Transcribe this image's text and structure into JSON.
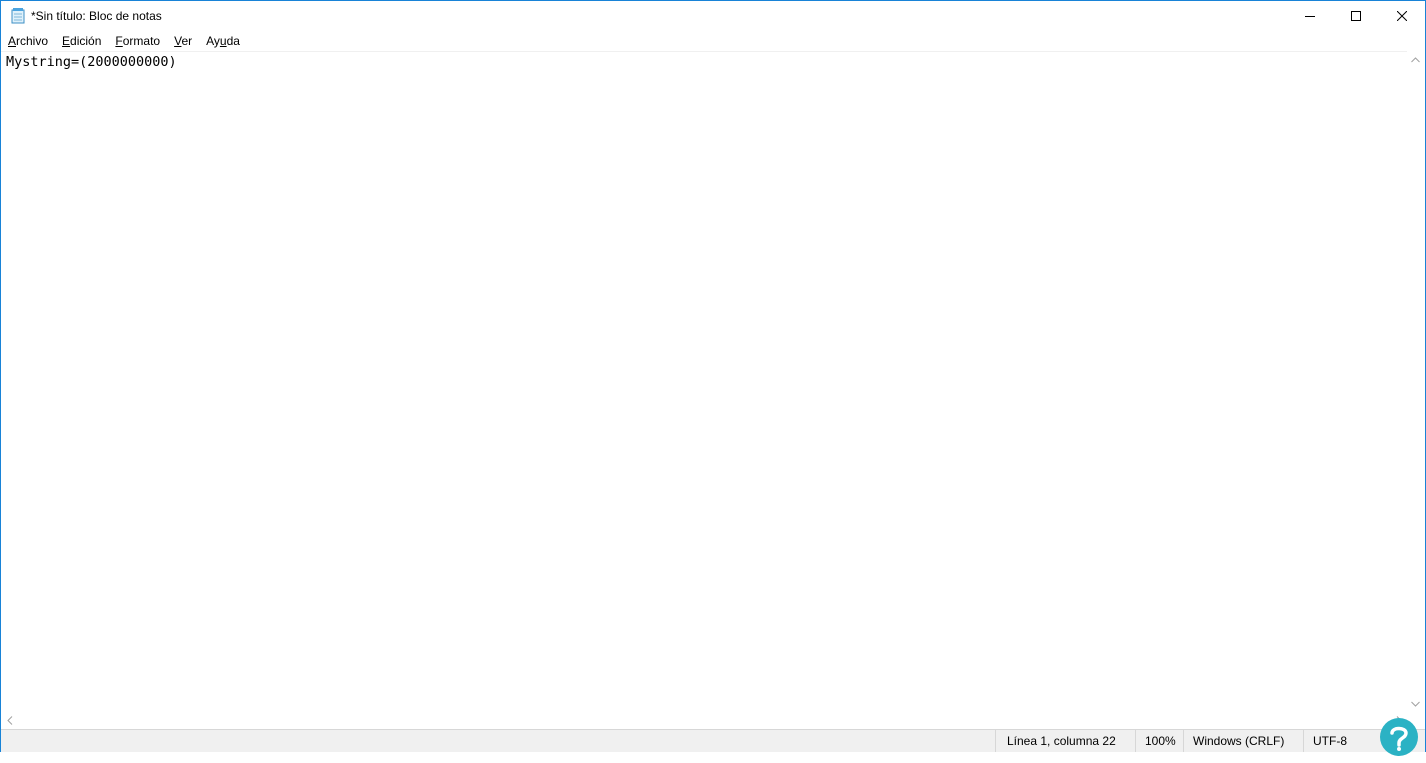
{
  "window": {
    "title": "*Sin título: Bloc de notas",
    "accent_color": "#1883d7"
  },
  "titlebar_buttons": {
    "minimize_icon": "minimize-icon",
    "maximize_icon": "maximize-icon",
    "close_icon": "close-icon"
  },
  "menu": {
    "items": [
      {
        "label": "Archivo",
        "mnemonic": "A",
        "rest": "rchivo"
      },
      {
        "label": "Edición",
        "mnemonic": "E",
        "rest": "dición"
      },
      {
        "label": "Formato",
        "mnemonic": "F",
        "rest": "ormato"
      },
      {
        "label": "Ver",
        "mnemonic": "V",
        "rest": "er"
      },
      {
        "label": "Ayuda",
        "pre": "Ay",
        "mnemonic": "u",
        "rest": "da"
      }
    ]
  },
  "editor": {
    "content": "Mystring=(2000000000)"
  },
  "statusbar": {
    "position": "Línea 1, columna 22",
    "zoom": "100%",
    "line_ending": "Windows (CRLF)",
    "encoding": "UTF-8"
  },
  "watermark": {
    "icon": "site-logo-icon",
    "color": "#2bb2c4"
  }
}
